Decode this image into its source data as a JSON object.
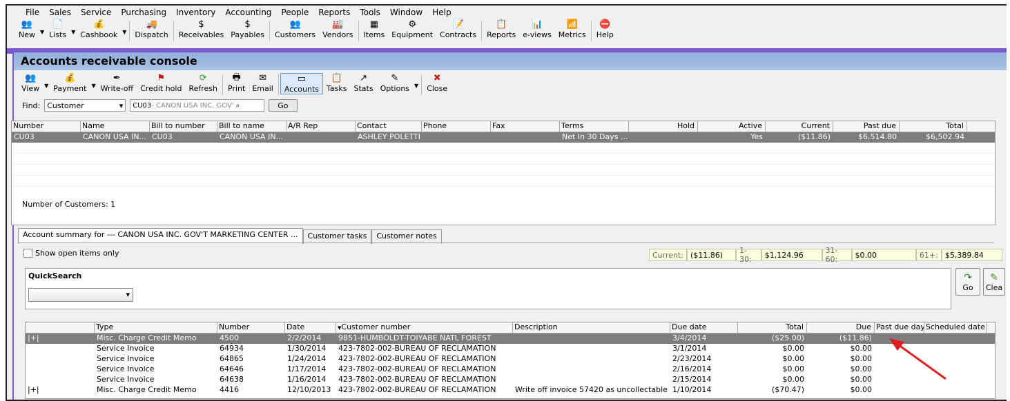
{
  "menu": [
    "File",
    "Sales",
    "Service",
    "Purchasing",
    "Inventory",
    "Accounting",
    "People",
    "Reports",
    "Tools",
    "Window",
    "Help"
  ],
  "main_toolbar": [
    "New",
    "Lists",
    "Cashbook",
    "Dispatch",
    "Receivables",
    "Payables",
    "Customers",
    "Vendors",
    "Items",
    "Equipment",
    "Contracts",
    "Reports",
    "e-views",
    "Metrics",
    "Help"
  ],
  "console": {
    "title": "Accounts receivable console",
    "toolbar": [
      "View",
      "Payment",
      "Write-off",
      "Credit hold",
      "Refresh",
      "Print",
      "Email",
      "Accounts",
      "Tasks",
      "Stats",
      "Options",
      "Close"
    ],
    "find_label": "Find:",
    "find_type": "Customer",
    "find_code": "CU03",
    "find_name": " - CANON USA INC. GOV'",
    "go_label": "Go"
  },
  "customers": {
    "columns": [
      "Number",
      "Name",
      "Bill to number",
      "Bill to name",
      "A/R Rep",
      "Contact",
      "Phone",
      "Fax",
      "Terms",
      "Hold",
      "Active",
      "Current",
      "Past due",
      "Total"
    ],
    "rows": [
      [
        "CU03",
        "CANON USA IN...",
        "CU03",
        "CANON USA IN...",
        "",
        "ASHLEY POLETTI",
        "",
        "",
        "Net In 30 Days ...",
        "",
        "Yes",
        "($11.86)",
        "$6,514.80",
        "$6,502.94"
      ]
    ],
    "count_label": "Number of Customers: 1"
  },
  "tabs": [
    "Account summary for ---   CANON USA INC. GOV'T MARKETING CENTER ...",
    "Customer tasks",
    "Customer notes"
  ],
  "show_open": "Show open items only",
  "aging": [
    {
      "label": "Current:",
      "value": "($11.86)"
    },
    {
      "label": "1-30:",
      "value": "$1,124.96"
    },
    {
      "label": "31-60:",
      "value": "$0.00"
    },
    {
      "label": "61+:",
      "value": "$5,389.84"
    }
  ],
  "quicksearch": {
    "title": "QuickSearch",
    "go": "Go",
    "clear": "Clea"
  },
  "items": {
    "columns": [
      "",
      "Type",
      "Number",
      "Date",
      "Customer number",
      "Description",
      "Due date",
      "Total",
      "Due",
      "Past due days",
      "Scheduled date"
    ],
    "rows": [
      [
        "|+|",
        "Misc. Charge Credit Memo",
        "4500",
        "2/2/2014",
        "9851-HUMBOLDT-TOIYABE NATL FOREST",
        "",
        "3/4/2014",
        "($25.00)",
        "($11.86)",
        "",
        ""
      ],
      [
        "",
        "Service Invoice",
        "64934",
        "1/30/2014",
        "423-7802-002-BUREAU OF RECLAMATION",
        "",
        "3/1/2014",
        "$0.00",
        "$0.00",
        "",
        ""
      ],
      [
        "",
        "Service Invoice",
        "64865",
        "1/24/2014",
        "423-7802-002-BUREAU OF RECLAMATION",
        "",
        "2/23/2014",
        "$0.00",
        "$0.00",
        "",
        ""
      ],
      [
        "",
        "Service Invoice",
        "64646",
        "1/17/2014",
        "423-7802-002-BUREAU OF RECLAMATION",
        "",
        "2/16/2014",
        "$0.00",
        "$0.00",
        "",
        ""
      ],
      [
        "",
        "Service Invoice",
        "64638",
        "1/16/2014",
        "423-7802-002-BUREAU OF RECLAMATION",
        "",
        "2/15/2014",
        "$0.00",
        "$0.00",
        "",
        ""
      ],
      [
        "|+|",
        "Misc. Charge Credit Memo",
        "4416",
        "12/10/2013",
        "423-7802-002-BUREAU OF RECLAMATION",
        "Write off invoice 57420 as uncollectable",
        "1/10/2014",
        "($70.47)",
        "$0.00",
        "",
        ""
      ]
    ]
  },
  "colors": {
    "accent": "#7b5ad0",
    "title_bg": "#9fbbe0",
    "selected_row": "#7d7d7d",
    "arrow": "#e02020"
  }
}
